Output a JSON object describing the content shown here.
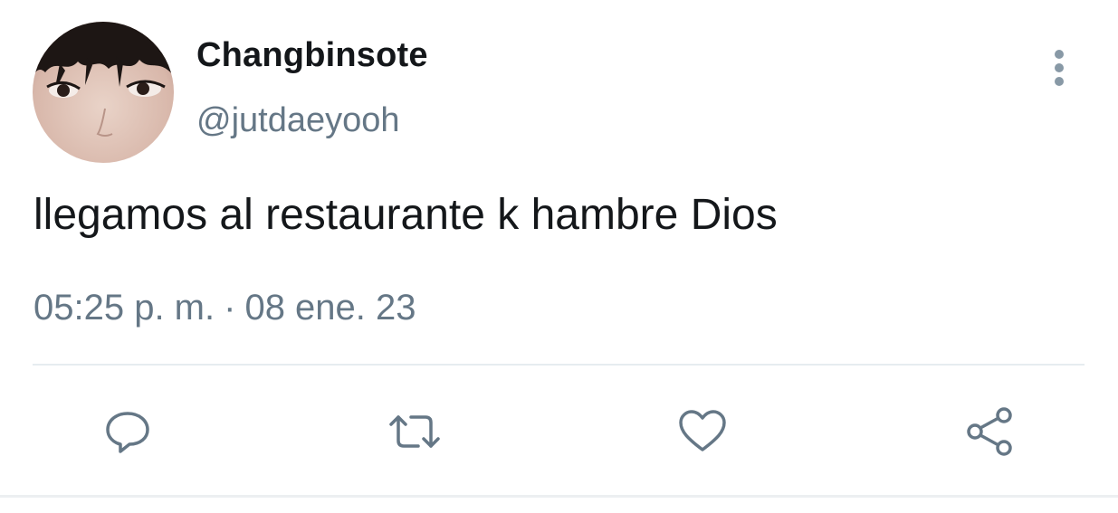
{
  "user": {
    "display_name": "Changbinsote",
    "handle": "@jutdaeyooh",
    "avatar_icon": "profile-photo"
  },
  "tweet": {
    "text": "llegamos al restaurante k hambre Dios",
    "time": "05:25 p. m.",
    "separator": "·",
    "date": "08 ene. 23"
  },
  "actions": [
    {
      "name": "reply",
      "icon": "comment-icon"
    },
    {
      "name": "retweet",
      "icon": "retweet-icon"
    },
    {
      "name": "like",
      "icon": "heart-icon"
    },
    {
      "name": "share",
      "icon": "share-icon"
    }
  ],
  "colors": {
    "text_primary": "#14171a",
    "text_secondary": "#657786",
    "divider": "#e6ecf0"
  }
}
